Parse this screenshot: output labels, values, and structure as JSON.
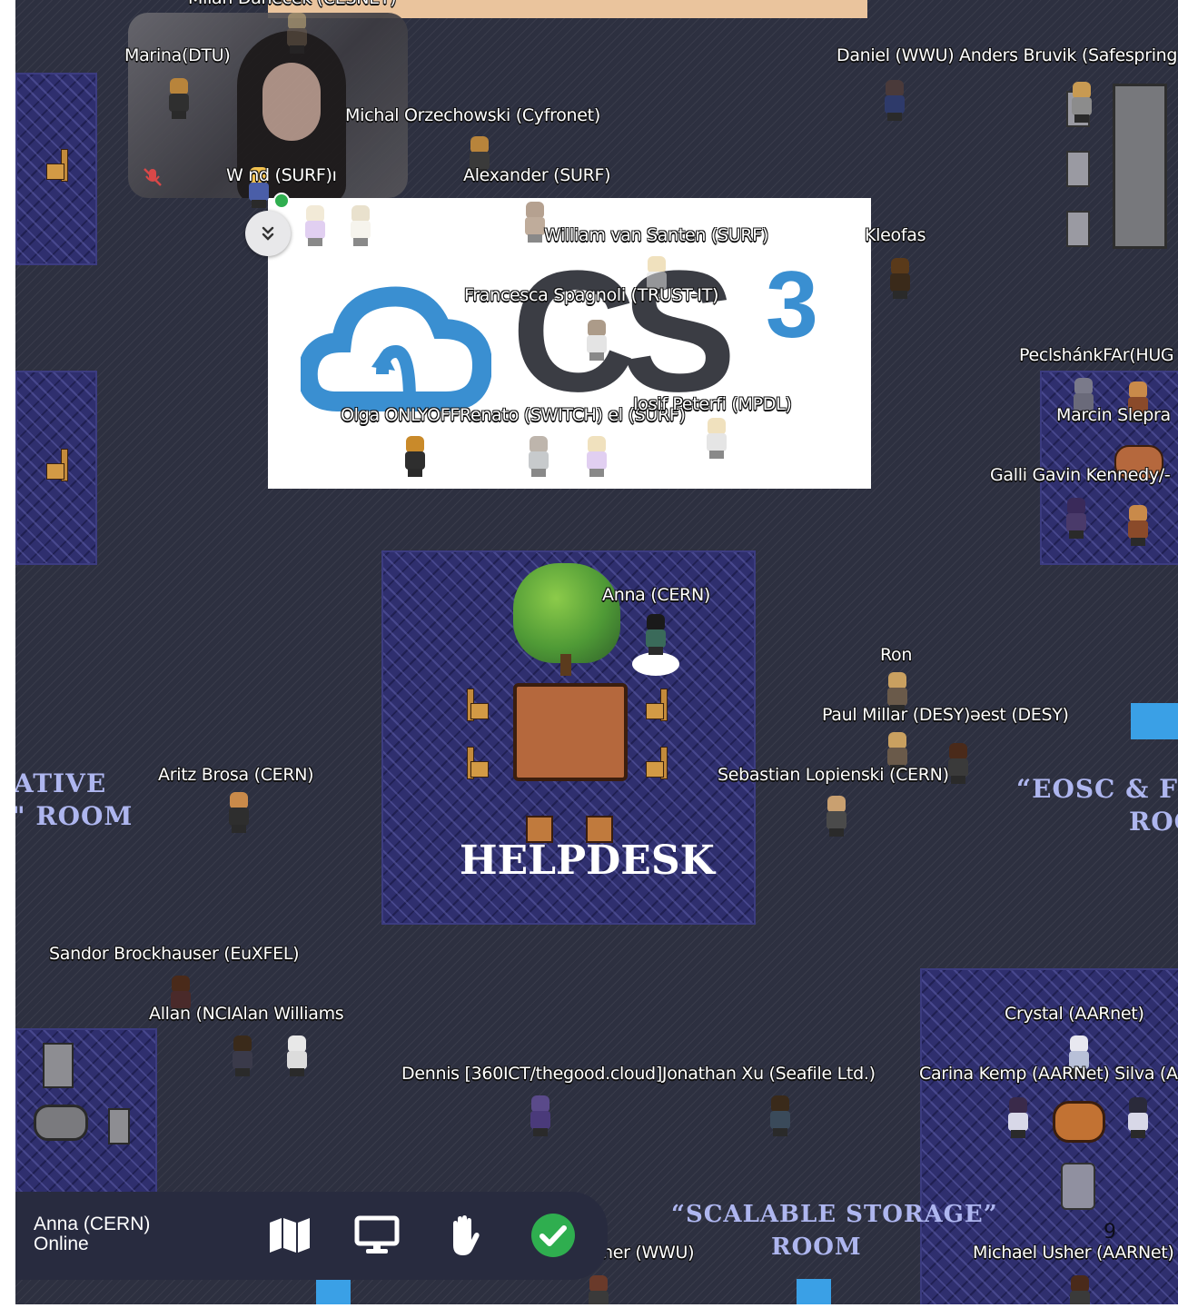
{
  "banner_partial": "Milan Daneček (CESNET)",
  "video_tile": {
    "name": "Marina(DTU)"
  },
  "logo": {
    "text": "CS",
    "superscript": "3"
  },
  "rooms": {
    "helpdesk": "HELPDESK",
    "left_line1": "ATIVE",
    "left_line2": "\" ROOM",
    "eosc_line1": "“EOSC & FED",
    "eosc_line2": "ROO",
    "storage_line1": "“SCALABLE STORAGE”",
    "storage_line2": "ROOM",
    "table_number": "9"
  },
  "players": [
    {
      "key": "michal",
      "name": "Michal Orzechowski (Cyfronet)"
    },
    {
      "key": "wsurf",
      "name": "W   nd (SURF)ı"
    },
    {
      "key": "alexander",
      "name": "Alexander (SURF)"
    },
    {
      "key": "daniel",
      "name": "Daniel (WWU) Anders Bruvik (Safespring"
    },
    {
      "key": "william",
      "name": "William van Santen (SURF)"
    },
    {
      "key": "kleofas",
      "name": "Kleofas"
    },
    {
      "key": "francesca",
      "name": "Francesca Spagnoli (TRUST-IT)"
    },
    {
      "key": "olga",
      "name": "Olga ONLYOFFRenato (SWITCH) el (SURF)"
    },
    {
      "key": "iosif",
      "name": "Iosif Peterfi (MPDL)"
    },
    {
      "key": "peclshank",
      "name": "PeclshánkFAr(HUG"
    },
    {
      "key": "marcin",
      "name": "Marcin Slepra"
    },
    {
      "key": "gavin",
      "name": "Galli Gavin Kennedy/-"
    },
    {
      "key": "anna",
      "name": "Anna (CERN)"
    },
    {
      "key": "ron",
      "name": "Ron"
    },
    {
      "key": "paul",
      "name": "Paul Millar (DESY)əest (DESY)"
    },
    {
      "key": "aritz",
      "name": "Aritz Brosa (CERN)"
    },
    {
      "key": "sebastian",
      "name": "Sebastian Lopienski (CERN)"
    },
    {
      "key": "sandor",
      "name": "Sandor Brockhauser (EuXFEL)"
    },
    {
      "key": "allan",
      "name": "Allan (NCIAlan Williams"
    },
    {
      "key": "crystal",
      "name": "Crystal (AARnet)"
    },
    {
      "key": "dennis",
      "name": "Dennis [360ICT/thegood.cloud]Jonathan Xu (Seafile Ltd.)"
    },
    {
      "key": "carina",
      "name": "Carina Kemp (AARNet) Silva (A"
    },
    {
      "key": "wwu",
      "name": "her (WWU)"
    },
    {
      "key": "michael",
      "name": "Michael Usher (AARNet)"
    }
  ],
  "toolbar": {
    "user_name": "Anna (CERN)",
    "status": "Online",
    "buttons": [
      "map-icon",
      "screen-share-icon",
      "raise-hand-icon",
      "check-icon"
    ]
  },
  "colors": {
    "accent_green": "#2fae4f",
    "toolbar_bg": "#282b3f",
    "carpet": "#2f2f6e",
    "floor": "#2d3040",
    "logo_blue": "#3a8fd1"
  }
}
